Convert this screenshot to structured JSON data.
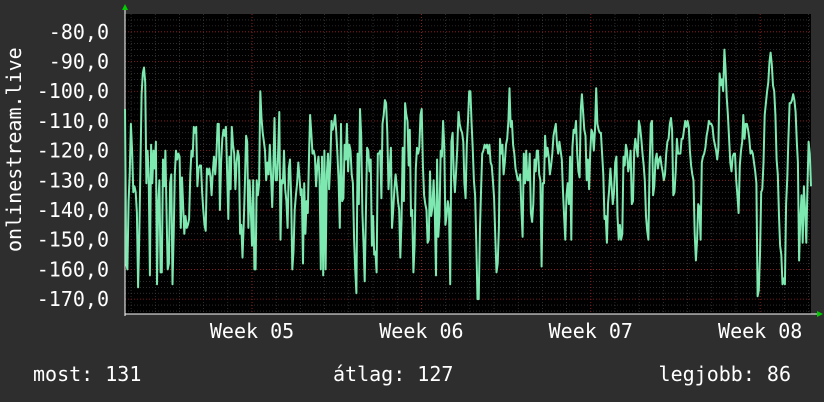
{
  "chart_data": {
    "type": "line",
    "title": "",
    "xlabel": "",
    "ylabel": "onlinestream.live",
    "ylim": [
      -175,
      -74
    ],
    "y_ticks": [
      -80,
      -90,
      -100,
      -110,
      -120,
      -130,
      -140,
      -150,
      -160,
      -170
    ],
    "y_tick_labels": [
      "-80,0",
      "-90,0",
      "-100,0",
      "-110,0",
      "-120,0",
      "-130,0",
      "-140,0",
      "-150,0",
      "-160,0",
      "-170,0"
    ],
    "x_range_weeks": [
      4.25,
      8.3
    ],
    "x_ticks": [
      5,
      6,
      7,
      8
    ],
    "x_tick_labels": [
      "Week 05",
      "Week 06",
      "Week 07",
      "Week 08"
    ],
    "grid": true,
    "colors": {
      "background": "#2e2e2e",
      "plot_background": "#000000",
      "line": "#7de8b0",
      "minor_grid": "#4a4a4a",
      "major_grid": "#a02020",
      "axis": "#ffffff",
      "arrow": "#00cc00"
    },
    "series": [
      {
        "values": [
          -106,
          -158,
          -160,
          -137,
          -128,
          -111,
          -120,
          -134,
          -132,
          -134,
          -141,
          -166,
          -150,
          -126,
          -101,
          -94,
          -92,
          -97,
          -131,
          -120,
          -129,
          -162,
          -118,
          -131,
          -120,
          -126,
          -117,
          -165,
          -138,
          -130,
          -161,
          -161,
          -123,
          -132,
          -120,
          -140,
          -160,
          -158,
          -131,
          -128,
          -165,
          -148,
          -128,
          -120,
          -123,
          -121,
          -122,
          -146,
          -129,
          -139,
          -148,
          -142,
          -146,
          -145,
          -143,
          -128,
          -120,
          -122,
          -112,
          -114,
          -112,
          -132,
          -126,
          -125,
          -125,
          -134,
          -140,
          -145,
          -147,
          -126,
          -128,
          -126,
          -129,
          -135,
          -127,
          -122,
          -128,
          -122,
          -111,
          -111,
          -140,
          -124,
          -116,
          -113,
          -115,
          -112,
          -127,
          -143,
          -122,
          -133,
          -112,
          -118,
          -121,
          -133,
          -124,
          -120,
          -122,
          -148,
          -145,
          -156,
          -145,
          -131,
          -115,
          -117,
          -146,
          -130,
          -140,
          -152,
          -130,
          -160,
          -160,
          -130,
          -135,
          -131,
          -100,
          -109,
          -114,
          -117,
          -120,
          -130,
          -124,
          -128,
          -118,
          -128,
          -139,
          -125,
          -109,
          -130,
          -130,
          -121,
          -107,
          -150,
          -130,
          -131,
          -120,
          -133,
          -137,
          -146,
          -126,
          -123,
          -136,
          -160,
          -154,
          -140,
          -135,
          -131,
          -124,
          -129,
          -135,
          -133,
          -158,
          -131,
          -148,
          -137,
          -141,
          -122,
          -108,
          -114,
          -121,
          -120,
          -122,
          -132,
          -125,
          -122,
          -130,
          -160,
          -122,
          -162,
          -120,
          -160,
          -128,
          -121,
          -133,
          -124,
          -110,
          -113,
          -111,
          -108,
          -114,
          -121,
          -130,
          -146,
          -111,
          -137,
          -136,
          -118,
          -123,
          -111,
          -127,
          -118,
          -120,
          -128,
          -131,
          -150,
          -160,
          -168,
          -121,
          -138,
          -106,
          -115,
          -141,
          -152,
          -164,
          -141,
          -119,
          -120,
          -127,
          -123,
          -152,
          -142,
          -155,
          -154,
          -161,
          -121,
          -121,
          -120,
          -136,
          -111,
          -108,
          -103,
          -104,
          -114,
          -133,
          -126,
          -119,
          -146,
          -140,
          -133,
          -128,
          -132,
          -137,
          -140,
          -156,
          -144,
          -119,
          -137,
          -104,
          -108,
          -110,
          -125,
          -113,
          -142,
          -140,
          -161,
          -152,
          -126,
          -119,
          -121,
          -119,
          -108,
          -106,
          -125,
          -135,
          -138,
          -140,
          -151,
          -150,
          -127,
          -142,
          -139,
          -130,
          -141,
          -162,
          -123,
          -149,
          -142,
          -120,
          -122,
          -110,
          -119,
          -145,
          -142,
          -137,
          -140,
          -165,
          -117,
          -114,
          -128,
          -134,
          -127,
          -119,
          -107,
          -111,
          -113,
          -114,
          -117,
          -131,
          -136,
          -118,
          -110,
          -100,
          -100,
          -111,
          -119,
          -130,
          -135,
          -151,
          -170,
          -170,
          -147,
          -133,
          -121,
          -120,
          -118,
          -119,
          -118,
          -121,
          -118,
          -124,
          -125,
          -130,
          -136,
          -149,
          -161,
          -158,
          -146,
          -116,
          -121,
          -118,
          -128,
          -124,
          -118,
          -116,
          -110,
          -99,
          -112,
          -110,
          -118,
          -121,
          -126,
          -128,
          -130,
          -130,
          -128,
          -140,
          -149,
          -121,
          -131,
          -120,
          -130,
          -130,
          -121,
          -141,
          -144,
          -138,
          -123,
          -127,
          -120,
          -120,
          -128,
          -130,
          -159,
          -131,
          -131,
          -115,
          -122,
          -119,
          -122,
          -128,
          -125,
          -121,
          -115,
          -113,
          -111,
          -118,
          -121,
          -117,
          -120,
          -123,
          -133,
          -142,
          -150,
          -135,
          -131,
          -138,
          -122,
          -150,
          -119,
          -113,
          -114,
          -110,
          -121,
          -127,
          -129,
          -106,
          -101,
          -107,
          -113,
          -115,
          -130,
          -123,
          -133,
          -121,
          -113,
          -114,
          -120,
          -113,
          -99,
          -111,
          -113,
          -114,
          -114,
          -121,
          -128,
          -143,
          -142,
          -151,
          -138,
          -133,
          -126,
          -132,
          -138,
          -134,
          -124,
          -122,
          -142,
          -150,
          -145,
          -150,
          -148,
          -122,
          -125,
          -118,
          -120,
          -127,
          -125,
          -120,
          -138,
          -137,
          -120,
          -116,
          -119,
          -122,
          -110,
          -112,
          -116,
          -121,
          -125,
          -130,
          -142,
          -147,
          -150,
          -125,
          -111,
          -110,
          -135,
          -132,
          -123,
          -121,
          -126,
          -123,
          -122,
          -125,
          -127,
          -130,
          -128,
          -121,
          -117,
          -116,
          -111,
          -109,
          -113,
          -135,
          -134,
          -127,
          -116,
          -121,
          -121,
          -121,
          -116,
          -116,
          -113,
          -110,
          -112,
          -110,
          -112,
          -120,
          -125,
          -128,
          -130,
          -148,
          -157,
          -150,
          -138,
          -139,
          -150,
          -124,
          -122,
          -121,
          -119,
          -115,
          -113,
          -110,
          -111,
          -111,
          -112,
          -116,
          -118,
          -120,
          -123,
          -119,
          -94,
          -98,
          -96,
          -100,
          -86,
          -92,
          -102,
          -108,
          -116,
          -124,
          -127,
          -122,
          -121,
          -121,
          -130,
          -135,
          -141,
          -125,
          -120,
          -117,
          -108,
          -116,
          -111,
          -111,
          -113,
          -116,
          -121,
          -120,
          -121,
          -124,
          -127,
          -131,
          -169,
          -167,
          -155,
          -134,
          -133,
          -124,
          -108,
          -104,
          -100,
          -97,
          -90,
          -87,
          -91,
          -98,
          -100,
          -108,
          -123,
          -128,
          -142,
          -152,
          -155,
          -165,
          -163,
          -165,
          -138,
          -129,
          -116,
          -104,
          -104,
          -103,
          -101,
          -103,
          -107,
          -117,
          -124,
          -157,
          -143,
          -135,
          -151,
          -132,
          -140,
          -151,
          -133,
          -117,
          -121,
          -132
        ]
      }
    ]
  },
  "legend": {
    "current": "most: 131",
    "average": "átlag: 127",
    "max": "legjobb: 86"
  }
}
